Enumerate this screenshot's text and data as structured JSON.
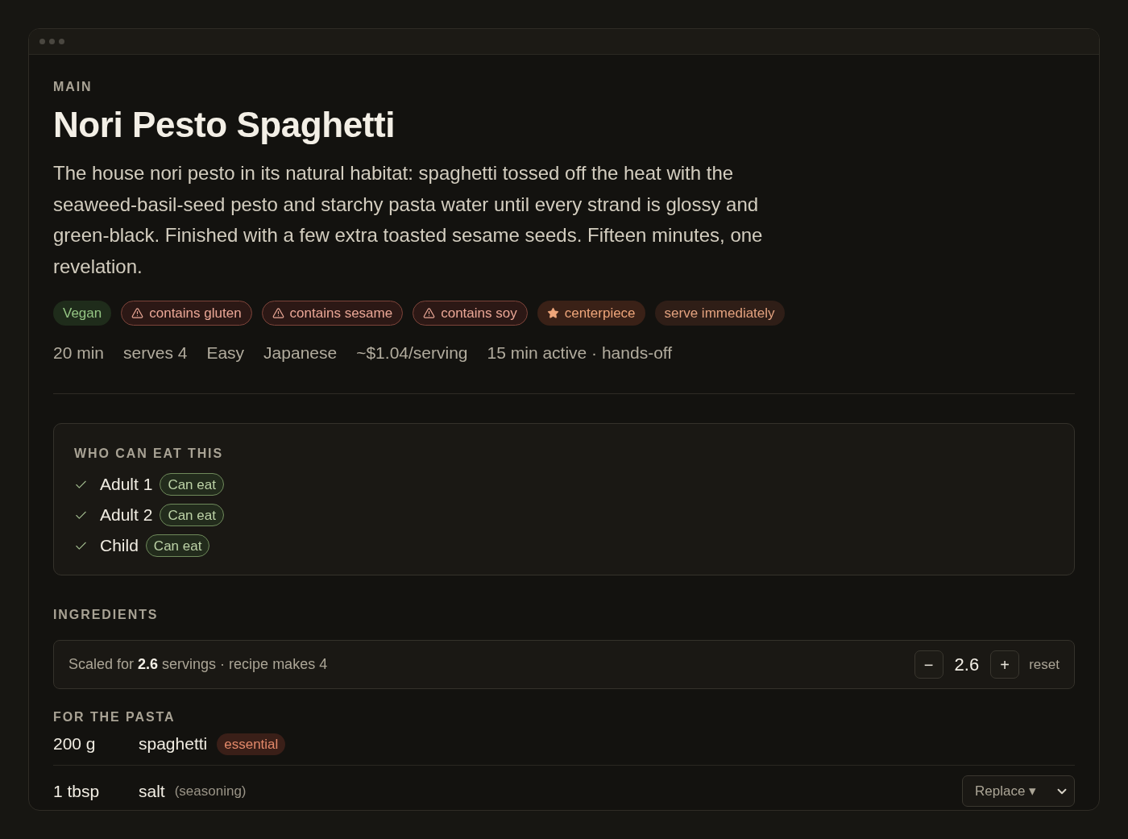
{
  "recipe": {
    "course": "MAIN",
    "title": "Nori Pesto Spaghetti",
    "description": "The house nori pesto in its natural habitat: spaghetti tossed off the heat with the seaweed-basil-seed pesto and starchy pasta water until every strand is glossy and green-black. Finished with a few extra toasted sesame seeds. Fifteen minutes, one revelation.",
    "tags": [
      {
        "kind": "diet",
        "label": "Vegan"
      },
      {
        "kind": "allergen",
        "label": "contains gluten"
      },
      {
        "kind": "allergen",
        "label": "contains sesame"
      },
      {
        "kind": "allergen",
        "label": "contains soy"
      },
      {
        "kind": "highlight",
        "label": "centerpiece"
      },
      {
        "kind": "note",
        "label": "serve immediately"
      }
    ],
    "meta": [
      "20 min",
      "serves 4",
      "Easy",
      "Japanese",
      "~$1.04/serving",
      "15 min active · hands-off"
    ]
  },
  "who_can_eat": {
    "heading": "WHO CAN EAT THIS",
    "people": [
      {
        "name": "Adult 1",
        "verdict": "Can eat",
        "checked": true
      },
      {
        "name": "Adult 2",
        "verdict": "Can eat",
        "checked": true
      },
      {
        "name": "Child",
        "verdict": "Can eat",
        "checked": true
      }
    ]
  },
  "ingredients": {
    "heading": "INGREDIENTS",
    "scaler": {
      "text": "Scaled for **2.6** servings · recipe makes 4",
      "minus": "−",
      "value": "2.6",
      "plus": "+",
      "reset": "reset"
    },
    "groups": [
      {
        "heading": "FOR THE PASTA",
        "items": [
          {
            "amount": "200 g",
            "name": "spaghetti",
            "badge": "essential"
          },
          {
            "amount": "1 tbsp",
            "name": "salt",
            "note": "(seasoning)",
            "action": "Replace ▾"
          }
        ]
      }
    ]
  }
}
